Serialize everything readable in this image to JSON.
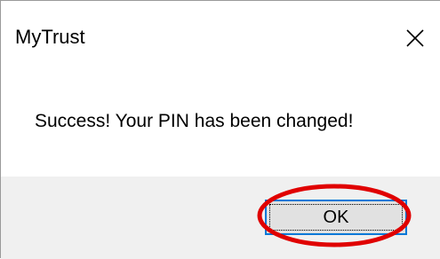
{
  "dialog": {
    "title": "MyTrust",
    "close_icon": "close-icon",
    "message": "Success! Your PIN has been changed!",
    "ok_label": "OK"
  },
  "colors": {
    "background": "#ffffff",
    "footer": "#f0f0f0",
    "button_face": "#e1e1e1",
    "button_focus_border": "#0078d7",
    "annotation": "#e00000"
  },
  "annotation": {
    "shape": "ellipse",
    "target": "ok-button"
  }
}
